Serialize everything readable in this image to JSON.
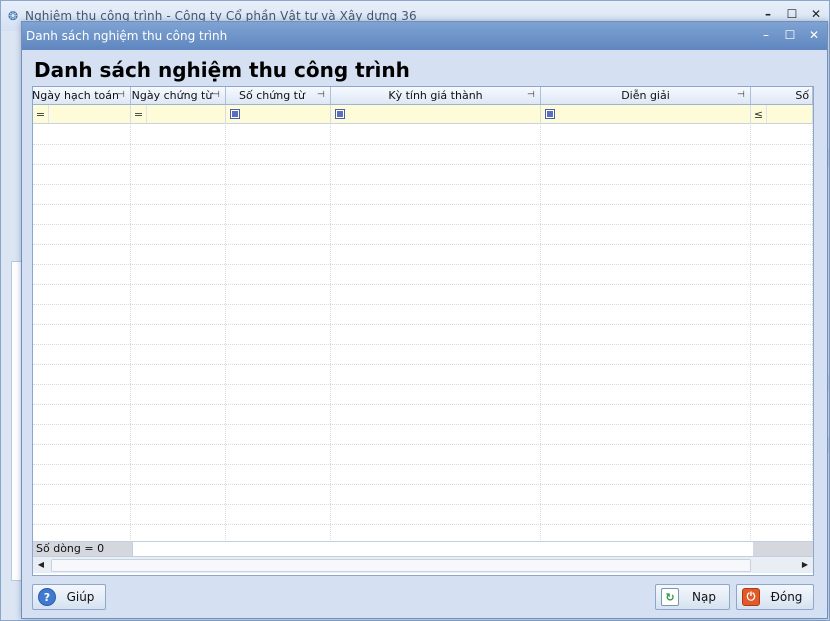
{
  "background_window": {
    "title": "Nghiệm thu công trình - Công ty Cổ phần Vật tư và Xây dựng 36"
  },
  "dialog": {
    "title": "Danh sách nghiệm thu công trình",
    "heading": "Danh sách nghiệm thu công trình"
  },
  "grid": {
    "columns": [
      {
        "label": "Ngày hạch toán",
        "filter_op": "="
      },
      {
        "label": "Ngày chứng từ",
        "filter_op": "="
      },
      {
        "label": "Số chứng từ",
        "filter_op": "checkbox"
      },
      {
        "label": "Kỳ tính giá thành",
        "filter_op": "checkbox"
      },
      {
        "label": "Diễn giải",
        "filter_op": "checkbox"
      },
      {
        "label": "Số ti",
        "filter_op": "≤"
      }
    ],
    "row_count_text": "Số dòng = 0",
    "empty_rows": 21
  },
  "buttons": {
    "help": "Giúp",
    "reload": "Nạp",
    "close": "Đóng"
  },
  "colors": {
    "dialog_titlebar": "#6f93c8",
    "filter_row": "#fdfbd8"
  }
}
